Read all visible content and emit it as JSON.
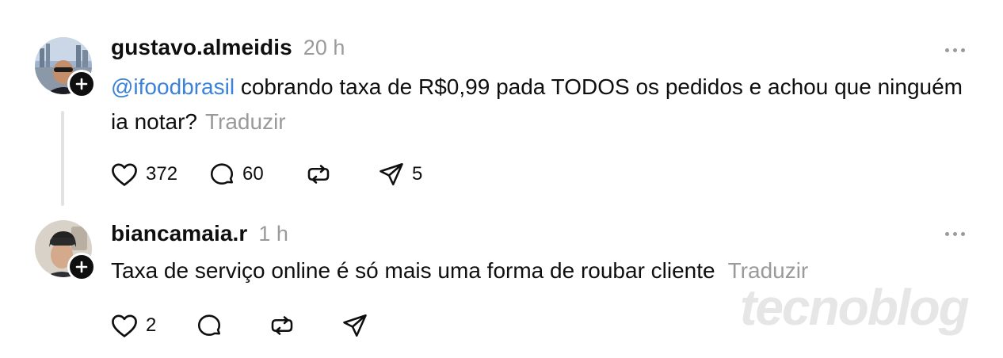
{
  "posts": [
    {
      "username": "gustavo.almeidis",
      "timestamp": "20 h",
      "mention": "@ifoodbrasil",
      "text": " cobrando taxa de R$0,99 pada TODOS os pedidos e achou que ninguém ia notar?",
      "translate": "Traduzir",
      "likes": "372",
      "replies": "60",
      "reposts": "",
      "shares": "5"
    },
    {
      "username": "biancamaia.r",
      "timestamp": "1 h",
      "text": "Taxa de serviço online é só mais uma forma de roubar cliente",
      "translate": "Traduzir",
      "likes": "2",
      "replies": "",
      "reposts": "",
      "shares": ""
    }
  ],
  "watermark": "tecnoblog",
  "colors": {
    "mention": "#3b82d8",
    "muted": "#9a9a9a",
    "text": "#0f0f0f",
    "thread_line": "#e2e2e2"
  },
  "icons": [
    "plus-icon",
    "more-icon",
    "heart-icon",
    "comment-icon",
    "repost-icon",
    "share-icon"
  ]
}
